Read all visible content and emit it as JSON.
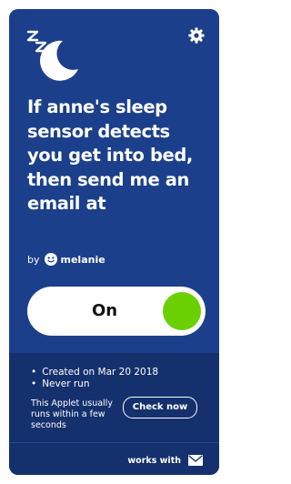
{
  "applet": {
    "title": "If anne's sleep sensor detects you get into bed, then send me an email at",
    "by_prefix": "by",
    "author": "melanie",
    "toggle_label": "On",
    "toggle_state": "on",
    "accent_color": "#1b3f8b",
    "toggle_on_color": "#6ad001"
  },
  "details": {
    "created": "Created on Mar 20 2018",
    "runs": "Never run",
    "note": "This Applet usually runs within a few seconds",
    "check_button": "Check now"
  },
  "footer": {
    "works_with_label": "works with",
    "service_icon": "mail-icon"
  },
  "icons": {
    "logo": "sleep-moon-icon",
    "settings": "gear-icon",
    "avatar": "smiley-avatar-icon"
  }
}
